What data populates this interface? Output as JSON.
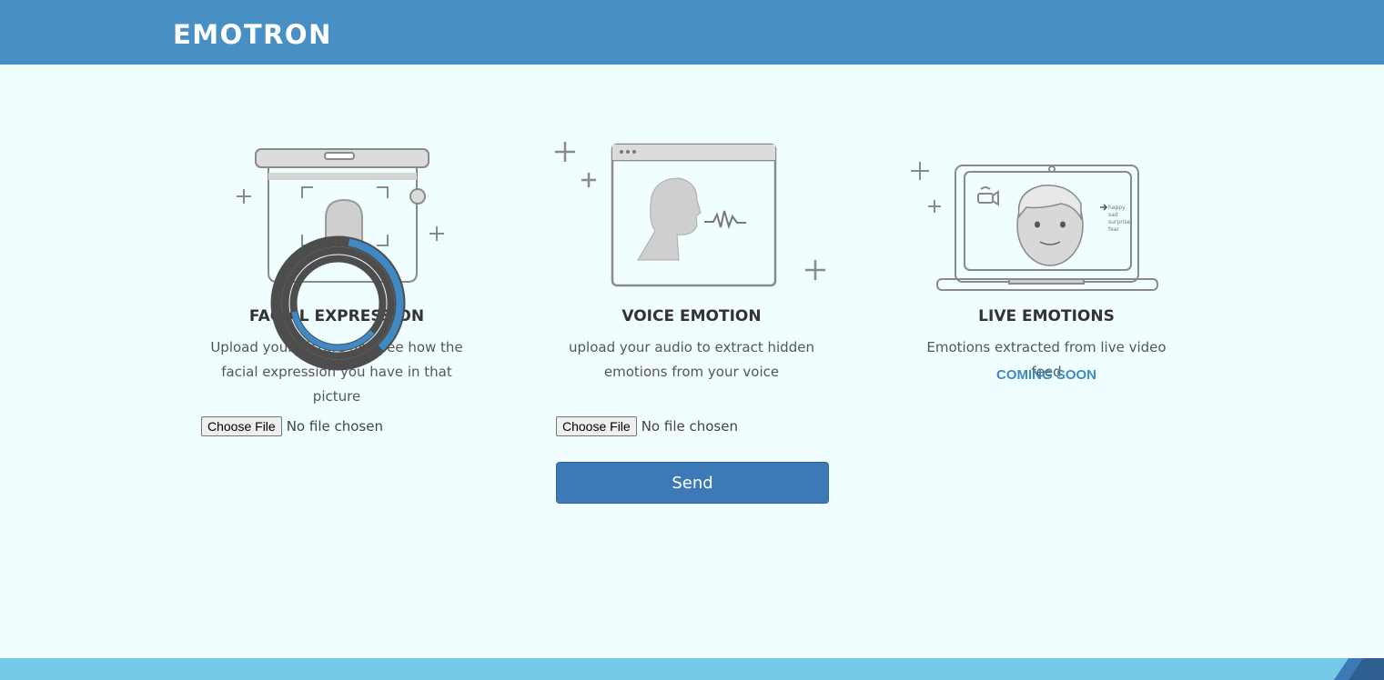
{
  "brand": "EMOTRON",
  "cards": [
    {
      "title": "FACIAL EXPRESSION",
      "description": "Upload your picture and see how the facial expression you have in that picture",
      "file_button": "Choose File",
      "file_status": "No file chosen"
    },
    {
      "title": "VOICE EMOTION",
      "description": "upload your audio to extract hidden emotions from your voice",
      "file_button": "Choose File",
      "file_status": "No file chosen"
    },
    {
      "title": "LIVE EMOTIONS",
      "description": "Emotions extracted from live video feed",
      "status": "COMING SOON",
      "emotion_list": [
        "happy",
        "sad",
        "surprise",
        "fear"
      ]
    }
  ],
  "send_button": "Send",
  "colors": {
    "header": "#478fc4",
    "background": "#f0feff",
    "accent": "#3c79b6",
    "footer": "#74cae6"
  }
}
